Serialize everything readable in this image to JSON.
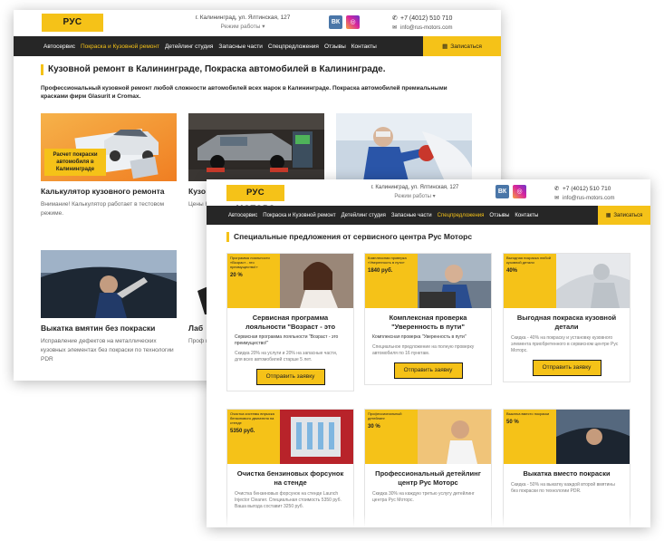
{
  "site": {
    "logo": "РУС МОТОРС",
    "address": "г. Калининград, ул. Ялтинская, 127",
    "work_mode": "Режим работы ▾",
    "phone": "+7 (4012) 510 710",
    "email": "info@rus-motors.com",
    "vk": "ВК",
    "ig": "◎",
    "signup": "Записаться",
    "nav": [
      "Автосервис",
      "Покраска и Кузовной ремонт",
      "Детейлинг студия",
      "Запасные части",
      "Спецпредложения",
      "Отзывы",
      "Контакты"
    ]
  },
  "page1": {
    "title": "Кузовной ремонт в Калининграде, Покраска автомобилей в Калининграде.",
    "intro": "Профессиональный кузовной ремонт любой сложности автомобилей всех марок в Калининграде. Покраска автомобилей премиальными красками фирм Glasurit и Cromax.",
    "services": [
      {
        "title": "Калькулятор кузовного ремонта",
        "text": "Внимание! Калькулятор работает в тестовом режиме.",
        "tag": "Расчет покраски автомобиля в Калининграде"
      },
      {
        "title": "Кузо",
        "text": "Цены Кали"
      },
      {
        "title": "",
        "text": ""
      },
      {
        "title": "Выкатка вмятин без покраски",
        "text": "Исправление дефектов на металлических кузовных элементах без покраски по технологии PDR"
      },
      {
        "title": "Лаб",
        "text": "Проф покр"
      }
    ]
  },
  "page2": {
    "title": "Специальные предложения от сервисного центра Рус Моторс",
    "button": "Отправить заявку",
    "offers": [
      {
        "title": "Сервисная программа лояльности \"Возраст - это",
        "sub": "Сервисная программа лояльности \"Возраст - это преимущество!\"",
        "text": "Скидка 20% на услуги и 20% на запасные части, для всех автомобилей старше 5 лет.",
        "box": "Программа лояльности «Возраст - это преимущество!»",
        "pct": "20 %"
      },
      {
        "title": "Комплексная проверка \"Уверенность в пути\"",
        "sub": "Комплексная проверка \"Уверенность в пути\"",
        "text": "Специальное предложение на полную проверку автомобиля по 16 пунктам.",
        "box": "Комплексная проверка «Уверенность в пути»",
        "pct": "1840 руб."
      },
      {
        "title": "Выгодная покраска кузовной детали",
        "sub": "",
        "text": "Скидка - 40% на покраску и установку кузовного элемента приобретенного в сервисном центре Рус Моторс.",
        "box": "Выгодная покраска любой кузовной детали",
        "pct": "40%"
      },
      {
        "title": "Очистка бензиновых форсунок на стенде",
        "sub": "",
        "text": "Очистка бензиновых форсунок на стенде Launch Injector Cleaner. Специальная стоимость 5350 руб. Ваша выгода составит 3250 руб.",
        "box": "Очистка системы впрыска бензинового двигателя на стенде",
        "pct": "5350 руб."
      },
      {
        "title": "Профессиональный детейлинг центр Рус Моторс",
        "sub": "",
        "text": "Скидка 30% на каждую третью услугу детейлинг центра Рус Моторс.",
        "box": "Профессиональный детейлинг",
        "pct": "30 %"
      },
      {
        "title": "Выкатка вместо покраски",
        "sub": "",
        "text": "Скидка - 50% на выкатку каждой второй вмятины без покраски по технологии PDR.",
        "box": "Выкатка вместо покраски",
        "pct": "50 %"
      }
    ]
  },
  "colors": {
    "accent": "#f5c218",
    "nav_bg": "#262626",
    "vk": "#4a76a8"
  }
}
